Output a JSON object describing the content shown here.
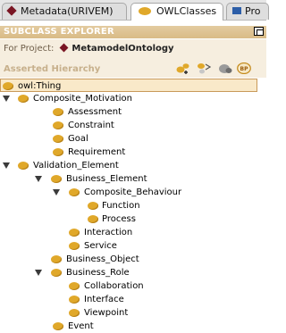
{
  "tabs": [
    {
      "label": "Metadata(URIVEM)",
      "icon": "diamond-icon",
      "active": false
    },
    {
      "label": "OWLClasses",
      "icon": "owl-class-icon",
      "active": true
    },
    {
      "label": "Pro",
      "icon": "properties-icon",
      "active": false
    }
  ],
  "panel": {
    "title": "SUBCLASS EXPLORER",
    "project_label": "For Project:",
    "project_name": "MetamodelOntology",
    "hierarchy_label": "Asserted Hierarchy"
  },
  "toolbar_icons": [
    "create-subclass-icon",
    "create-sibling-icon",
    "delete-class-icon",
    "owl-badge-icon"
  ],
  "tree": [
    {
      "label": "owl:Thing",
      "depth": 0,
      "expanded": null,
      "selected": true
    },
    {
      "label": "Composite_Motivation",
      "depth": 0,
      "expanded": true
    },
    {
      "label": "Assessment",
      "depth": 1
    },
    {
      "label": "Constraint",
      "depth": 1
    },
    {
      "label": "Goal",
      "depth": 1
    },
    {
      "label": "Requirement",
      "depth": 1
    },
    {
      "label": "Validation_Element",
      "depth": 0,
      "expanded": true
    },
    {
      "label": "Business_Element",
      "depth": 1,
      "expanded": true
    },
    {
      "label": "Composite_Behaviour",
      "depth": 2,
      "expanded": true
    },
    {
      "label": "Function",
      "depth": 3
    },
    {
      "label": "Process",
      "depth": 3
    },
    {
      "label": "Interaction",
      "depth": 2
    },
    {
      "label": "Service",
      "depth": 2
    },
    {
      "label": "Business_Object",
      "depth": 1
    },
    {
      "label": "Business_Role",
      "depth": 1,
      "expanded": true
    },
    {
      "label": "Collaboration",
      "depth": 2
    },
    {
      "label": "Interface",
      "depth": 2
    },
    {
      "label": "Viewpoint",
      "depth": 2
    },
    {
      "label": "Event",
      "depth": 0
    }
  ],
  "colors": {
    "class_node": "#e0a82a",
    "header_bg": "#d9bb86",
    "selection_bg": "#f9e9c9",
    "project_bg": "#f6eedf"
  }
}
